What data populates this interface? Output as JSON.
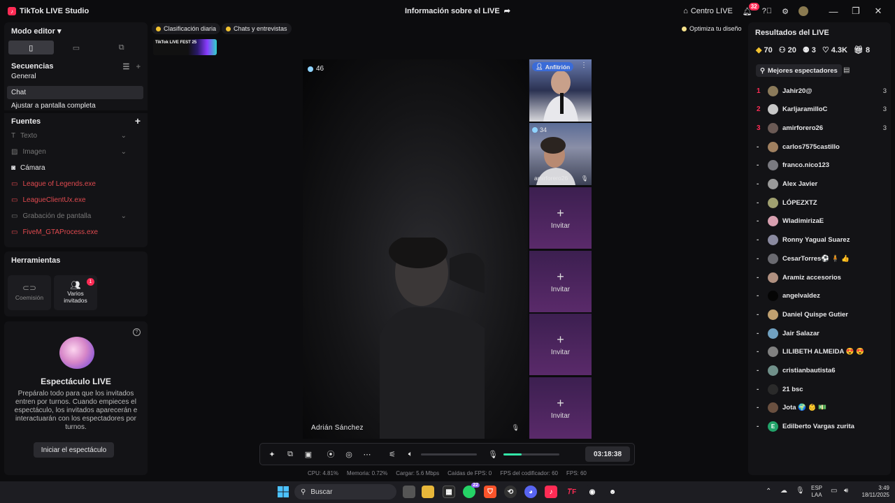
{
  "titlebar": {
    "app_title": "TikTok LIVE Studio",
    "center_title": "Información sobre el LIVE",
    "centro_live": "Centro LIVE",
    "notif_count": "32"
  },
  "left": {
    "modo_editor": "Modo editor",
    "secuencias": "Secuencias",
    "seq_items": [
      "General",
      "Chat",
      "Ajustar a pantalla completa"
    ],
    "fuentes": "Fuentes",
    "sources": [
      {
        "label": "Texto",
        "style": "dim",
        "icon": "text-icon"
      },
      {
        "label": "Imagen",
        "style": "dim",
        "icon": "image-icon"
      },
      {
        "label": "Cámara",
        "style": "white",
        "icon": "camera-icon"
      },
      {
        "label": "League of Legends.exe",
        "style": "red",
        "icon": "window-icon"
      },
      {
        "label": "LeagueClientUx.exe",
        "style": "red",
        "icon": "window-icon"
      },
      {
        "label": "Grabación de pantalla",
        "style": "dim",
        "icon": "screen-icon"
      },
      {
        "label": "FiveM_GTAProcess.exe",
        "style": "red",
        "icon": "window-icon"
      }
    ],
    "herramientas": "Herramientas",
    "tools": [
      {
        "label": "Coemisión"
      },
      {
        "label": "Varios invitados",
        "badge": "1"
      }
    ],
    "show_title": "Espectáculo LIVE",
    "show_desc": "Prepáralo todo para que los invitados entren por turnos. Cuando empieces el espectáculo, los invitados aparecerán e interactuarán con los espectadores por turnos.",
    "show_button": "Iniciar el espectáculo"
  },
  "center": {
    "chip_daily": "Clasificación diaria",
    "chip_chats": "Chats y entrevistas",
    "chip_optimize": "Optimiza tu diseño",
    "fest_banner": "TikTok LIVE FEST 25",
    "stage_viewers": "46",
    "stage_name": "Adrián Sánchez",
    "host_badge": "Anfitrión",
    "guest2_viewers": "34",
    "guest2_name": "amirforero26",
    "invite_label": "Invitar",
    "timer": "03:18:38",
    "mic_level": 0.32,
    "stats": {
      "cpu": "CPU: 4.81%",
      "mem": "Memoria: 0.72%",
      "load": "Cargar: 5.6 Mbps",
      "fps_drop": "Caídas de FPS: 0",
      "enc_fps": "FPS del codificador: 60",
      "fps": "FPS: 60"
    }
  },
  "right": {
    "title": "Resultados del LIVE",
    "stats": [
      "70",
      "20",
      "3",
      "4.3K",
      "8"
    ],
    "tab_viewers": "Mejores espectadores",
    "viewers": [
      {
        "rank": "1",
        "name": "Jahir20@",
        "score": "3",
        "color": "#8b7a5a"
      },
      {
        "rank": "2",
        "name": "KarljaramilloC",
        "score": "3",
        "color": "#c7c7c7"
      },
      {
        "rank": "3",
        "name": "amirforero26",
        "score": "3",
        "color": "#6b5a55"
      },
      {
        "rank": "-",
        "name": "carlos7575castillo",
        "score": "",
        "color": "#a08060"
      },
      {
        "rank": "-",
        "name": "franco.nico123",
        "score": "",
        "color": "#7a7a80"
      },
      {
        "rank": "-",
        "name": "Alex Javier",
        "score": "",
        "color": "#9a9a9a"
      },
      {
        "rank": "-",
        "name": "LÓPEZXTZ",
        "score": "",
        "color": "#a0a070"
      },
      {
        "rank": "-",
        "name": "WladimirizaE",
        "score": "",
        "color": "#d8a0b0"
      },
      {
        "rank": "-",
        "name": "Ronny Yagual Suarez",
        "score": "",
        "color": "#8a8aa0"
      },
      {
        "rank": "-",
        "name": "CesarTorres⚽ 🧍 👍",
        "score": "",
        "color": "#6a6a70"
      },
      {
        "rank": "-",
        "name": "Aramiz accesorios",
        "score": "",
        "color": "#b09080"
      },
      {
        "rank": "-",
        "name": "angelvaldez",
        "score": "",
        "color": "#050505"
      },
      {
        "rank": "-",
        "name": "Daniel Quispe Gutier",
        "score": "",
        "color": "#c0a070"
      },
      {
        "rank": "-",
        "name": "Jair Salazar",
        "score": "",
        "color": "#70a0c0"
      },
      {
        "rank": "-",
        "name": "LILIBETH ALMEIDA 😍 😍",
        "score": "",
        "color": "#808080"
      },
      {
        "rank": "-",
        "name": "cristianbautista6",
        "score": "",
        "color": "#70908a"
      },
      {
        "rank": "-",
        "name": "21 bsc",
        "score": "",
        "color": "#2a2a2a"
      },
      {
        "rank": "-",
        "name": "Jota 🌍 👶 💵",
        "score": "",
        "color": "#6a5040"
      },
      {
        "rank": "-",
        "name": "Edilberto Vargas zurita",
        "score": "",
        "color": "#22a36a",
        "initial": "E"
      }
    ]
  },
  "taskbar": {
    "search": "Buscar",
    "whatsapp_badge": "22",
    "lang": "ESP",
    "lang2": "LAA",
    "time": "3:49",
    "date": "18/11/2025"
  }
}
